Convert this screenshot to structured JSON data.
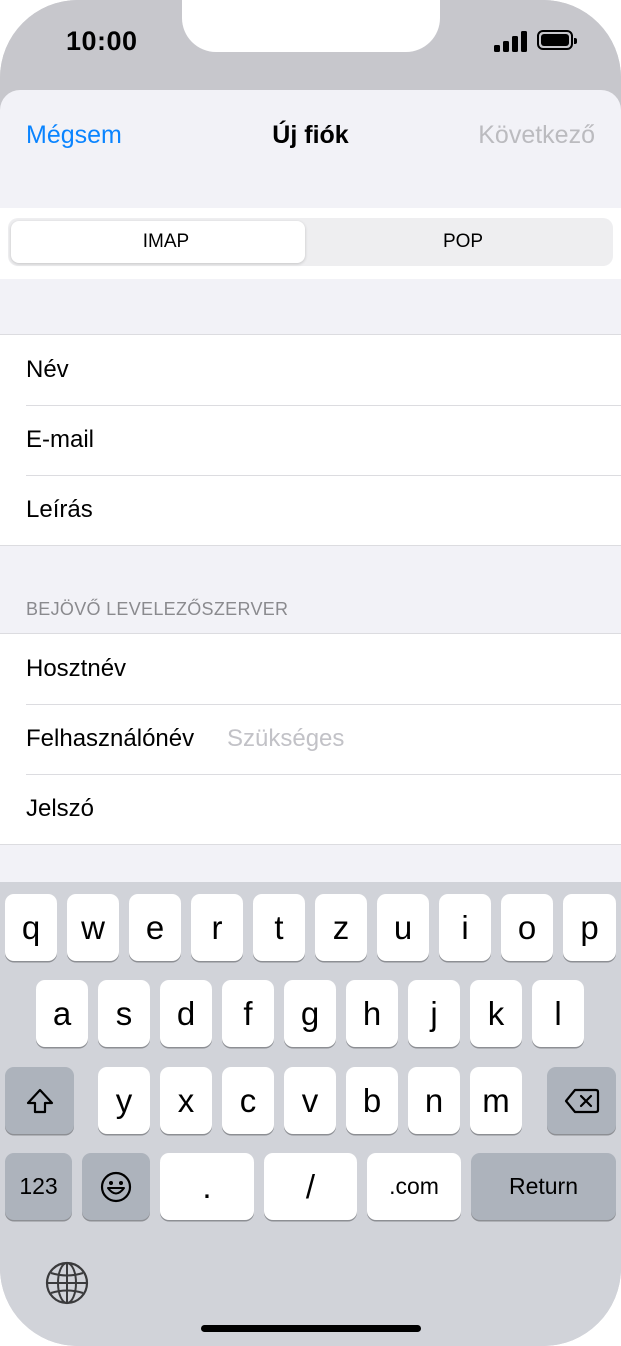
{
  "status_bar": {
    "time": "10:00"
  },
  "nav": {
    "cancel_label": "Mégsem",
    "title": "Új fiók",
    "next_label": "Következő"
  },
  "segmented": {
    "options": [
      "IMAP",
      "POP"
    ],
    "selected": "IMAP"
  },
  "account_group": {
    "rows": [
      {
        "label": "Név"
      },
      {
        "label": "E-mail"
      },
      {
        "label": "Leírás"
      }
    ]
  },
  "incoming_server": {
    "header": "BEJÖVŐ LEVELEZŐSZERVER",
    "rows": [
      {
        "label": "Hosztnév",
        "placeholder": ""
      },
      {
        "label": "Felhasználónév",
        "placeholder": "Szükséges"
      },
      {
        "label": "Jelszó",
        "placeholder": ""
      }
    ]
  },
  "keyboard": {
    "row1": [
      "q",
      "w",
      "e",
      "r",
      "t",
      "z",
      "u",
      "i",
      "o",
      "p"
    ],
    "row2": [
      "a",
      "s",
      "d",
      "f",
      "g",
      "h",
      "j",
      "k",
      "l"
    ],
    "row3": [
      "y",
      "x",
      "c",
      "v",
      "b",
      "n",
      "m"
    ],
    "numbers_label": "123",
    "dot_label": ".",
    "slash_label": "/",
    "com_label": ".com",
    "return_label": "Return",
    "icons": {
      "shift": "shift-icon",
      "delete": "delete-icon",
      "emoji": "emoji-icon",
      "globe": "globe-icon"
    }
  },
  "colors": {
    "accent": "#0a84ff",
    "disabled": "#bbbbbf",
    "placeholder": "#c2c2c7"
  }
}
